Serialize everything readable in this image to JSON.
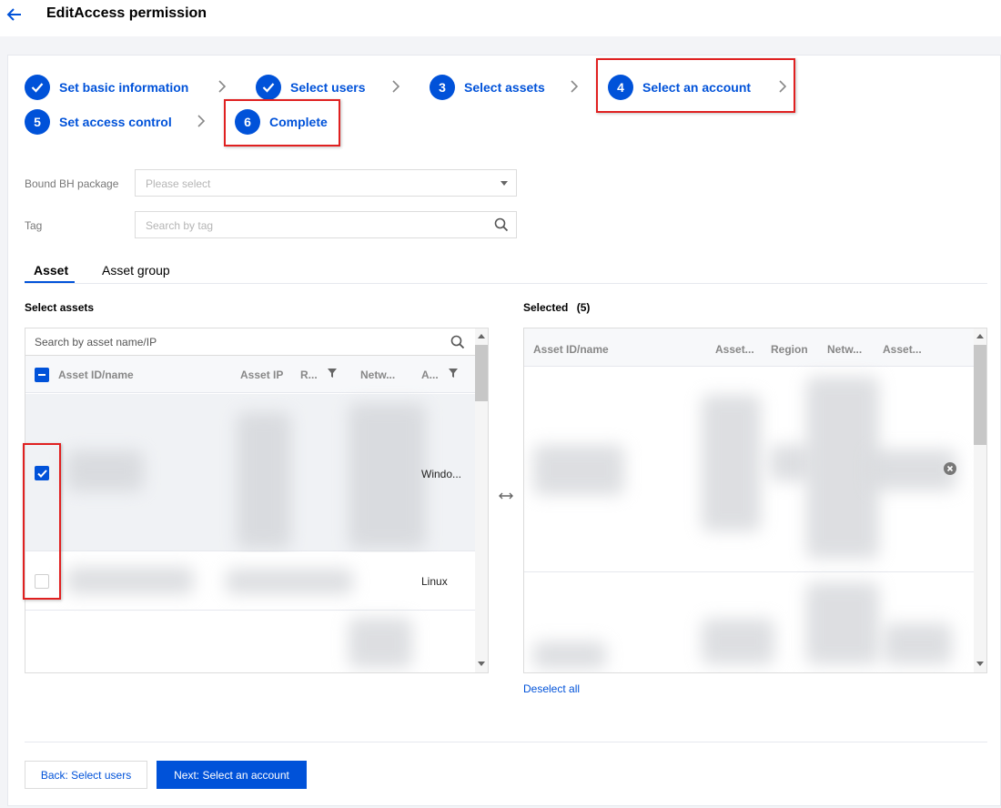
{
  "header": {
    "title": "EditAccess permission"
  },
  "steps": [
    {
      "num": "",
      "label": "Set basic information",
      "done": true
    },
    {
      "num": "",
      "label": "Select users",
      "done": true
    },
    {
      "num": "3",
      "label": "Select assets"
    },
    {
      "num": "4",
      "label": "Select an account"
    },
    {
      "num": "5",
      "label": "Set access control"
    },
    {
      "num": "6",
      "label": "Complete"
    }
  ],
  "form": {
    "package_label": "Bound BH package",
    "package_placeholder": "Please select",
    "tag_label": "Tag",
    "tag_placeholder": "Search by tag"
  },
  "tabs": [
    "Asset",
    "Asset group"
  ],
  "left_panel": {
    "title": "Select assets",
    "search_placeholder": "Search by asset name/IP",
    "columns": [
      "Asset ID/name",
      "Asset IP",
      "R...",
      "Netw...",
      "A..."
    ],
    "rows": [
      {
        "checked": true,
        "os": "Windo..."
      },
      {
        "checked": false,
        "os": "Linux"
      }
    ]
  },
  "right_panel": {
    "title": "Selected",
    "count": "(5)",
    "columns": [
      "Asset ID/name",
      "Asset...",
      "Region",
      "Netw...",
      "Asset..."
    ],
    "deselect_all": "Deselect all"
  },
  "buttons": {
    "back": "Back: Select users",
    "next": "Next: Select an account"
  },
  "colors": {
    "primary": "#0052d9",
    "highlight": "#e02020"
  }
}
